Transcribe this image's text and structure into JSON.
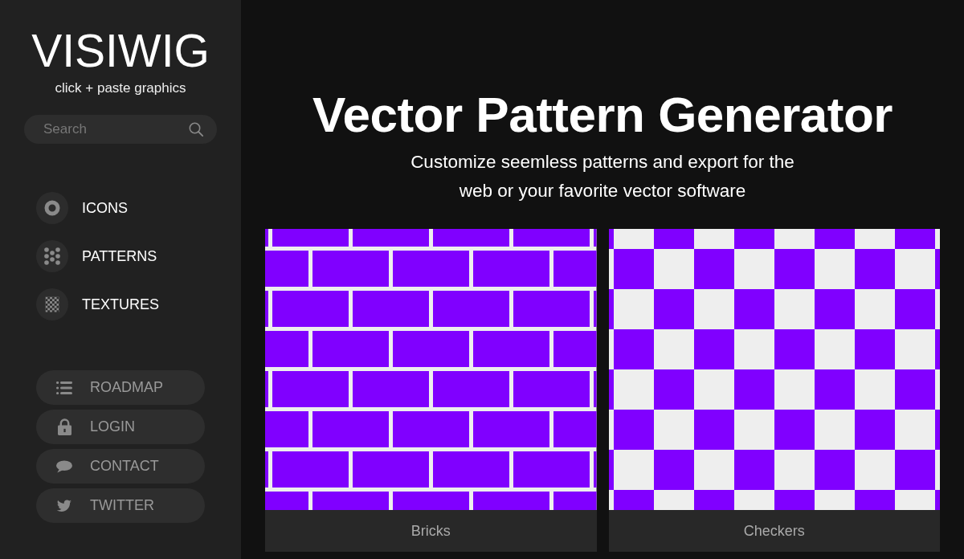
{
  "sidebar": {
    "logo": "VISIWIG",
    "tagline": "click + paste graphics",
    "search": {
      "placeholder": "Search"
    },
    "nav_items": [
      {
        "label": "ICONS"
      },
      {
        "label": "PATTERNS"
      },
      {
        "label": "TEXTURES"
      }
    ],
    "link_buttons": [
      {
        "label": "ROADMAP"
      },
      {
        "label": "LOGIN"
      },
      {
        "label": "CONTACT"
      },
      {
        "label": "TWITTER"
      }
    ]
  },
  "main": {
    "title": "Vector Pattern Generator",
    "subtitle": "Customize seemless patterns and export for the web or your favorite vector software",
    "patterns": [
      {
        "name": "Bricks",
        "kind": "bricks"
      },
      {
        "name": "Checkers",
        "kind": "checkers"
      }
    ]
  }
}
